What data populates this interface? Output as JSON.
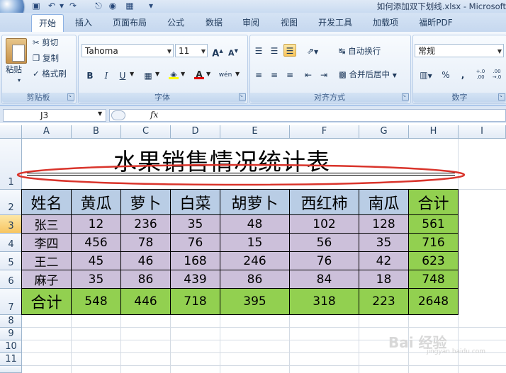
{
  "window": {
    "title": "如何添加双下划线.xlsx - Microsoft"
  },
  "tabs": [
    "开始",
    "插入",
    "页面布局",
    "公式",
    "数据",
    "审阅",
    "视图",
    "开发工具",
    "加载项",
    "福昕PDF"
  ],
  "ribbon": {
    "clipboard": {
      "paste": "粘贴",
      "cut": "剪切",
      "copy": "复制",
      "format_painter": "格式刷",
      "label": "剪贴板"
    },
    "font": {
      "name": "Tahoma",
      "size": "11",
      "label": "字体",
      "grow": "A",
      "shrink": "A",
      "bold": "B",
      "italic": "I",
      "underline": "U",
      "phonetic": "wén"
    },
    "alignment": {
      "wrap_text": "自动换行",
      "merge_center": "合并后居中",
      "label": "对齐方式"
    },
    "number": {
      "format": "常规",
      "label": "数字",
      "percent": "%",
      "comma": ",",
      "inc_decimal": "+.0 .00",
      "dec_decimal": ".00 →.0"
    }
  },
  "formula_bar": {
    "name_box": "J3",
    "fx": "fx",
    "value": ""
  },
  "columns": [
    "A",
    "B",
    "C",
    "D",
    "E",
    "F",
    "G",
    "H",
    "I"
  ],
  "rows": [
    "1",
    "2",
    "3",
    "4",
    "5",
    "6",
    "7",
    "8",
    "9",
    "10",
    "11"
  ],
  "sheet": {
    "title": "水果销售情况统计表",
    "headers": [
      "姓名",
      "黄瓜",
      "萝卜",
      "白菜",
      "胡萝卜",
      "西红柿",
      "南瓜",
      "合计"
    ],
    "data": [
      [
        "张三",
        "12",
        "236",
        "35",
        "48",
        "102",
        "128",
        "561"
      ],
      [
        "李四",
        "456",
        "78",
        "76",
        "15",
        "56",
        "35",
        "716"
      ],
      [
        "王二",
        "45",
        "46",
        "168",
        "246",
        "76",
        "42",
        "623"
      ],
      [
        "麻子",
        "35",
        "86",
        "439",
        "86",
        "84",
        "18",
        "748"
      ]
    ],
    "totals": [
      "合计",
      "548",
      "446",
      "718",
      "395",
      "318",
      "223",
      "2648"
    ]
  },
  "colors": {
    "header_fill": "#b9cde5",
    "data_fill": "#ccc0da",
    "total_fill": "#92d050",
    "ellipse": "#d9342b"
  },
  "watermark": {
    "text": "Bai 经验",
    "sub": "jingyan.baidu.com"
  }
}
